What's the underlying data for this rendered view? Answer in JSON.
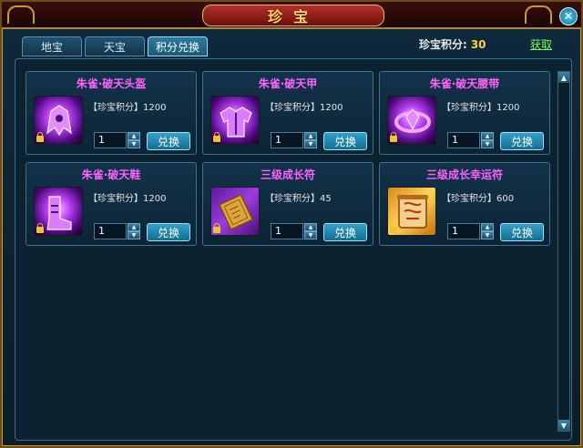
{
  "window": {
    "title": "珍宝"
  },
  "tabs": [
    {
      "label": "地宝"
    },
    {
      "label": "天宝"
    },
    {
      "label": "积分兑换"
    }
  ],
  "points": {
    "label": "珍宝积分:",
    "value": "30"
  },
  "obtain_label": "获取",
  "items": [
    {
      "name": "朱雀·破天头盔",
      "price": "【珍宝积分】1200",
      "qty": "1",
      "button": "兑换",
      "icon": "purple-helmet-icon"
    },
    {
      "name": "朱雀·破天甲",
      "price": "【珍宝积分】1200",
      "qty": "1",
      "button": "兑换",
      "icon": "purple-armor-icon"
    },
    {
      "name": "朱雀·破天腰带",
      "price": "【珍宝积分】1200",
      "qty": "1",
      "button": "兑换",
      "icon": "purple-belt-icon"
    },
    {
      "name": "朱雀·破天鞋",
      "price": "【珍宝积分】1200",
      "qty": "1",
      "button": "兑换",
      "icon": "purple-boots-icon"
    },
    {
      "name": "三级成长符",
      "price": "【珍宝积分】45",
      "qty": "1",
      "button": "兑换",
      "icon": "scroll-growth-icon"
    },
    {
      "name": "三级成长幸运符",
      "price": "【珍宝积分】600",
      "qty": "1",
      "button": "兑换",
      "icon": "scroll-lucky-icon"
    }
  ],
  "colors": {
    "item_name": "#ff62ff",
    "points_value": "#ffd23a",
    "obtain_link": "#7cff5a"
  }
}
